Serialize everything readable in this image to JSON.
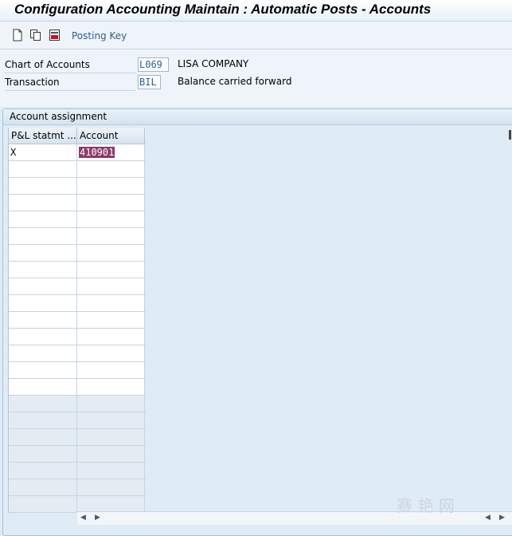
{
  "window": {
    "title": "Configuration Accounting Maintain : Automatic Posts - Accounts"
  },
  "toolbar": {
    "icons": [
      "new-document-icon",
      "copy-icon",
      "delete-icon"
    ],
    "posting_key_label": "Posting Key"
  },
  "fields": {
    "chart_of_accounts": {
      "label": "Chart of Accounts",
      "value": "L069",
      "description": "LISA COMPANY"
    },
    "transaction": {
      "label": "Transaction",
      "value": "BIL",
      "description": "Balance carried forward"
    }
  },
  "account_assignment": {
    "title": "Account assignment",
    "columns": [
      "P&L statmt ...",
      "Account"
    ],
    "rows": [
      {
        "pl_statement": "X",
        "account": "410901"
      }
    ],
    "empty_rows_white": 14,
    "empty_rows_grey": 7
  },
  "watermark": "赛 艳 网",
  "colors": {
    "background": "#dfebf5",
    "link": "#2a5f96",
    "selection": "#8a3a6c"
  }
}
